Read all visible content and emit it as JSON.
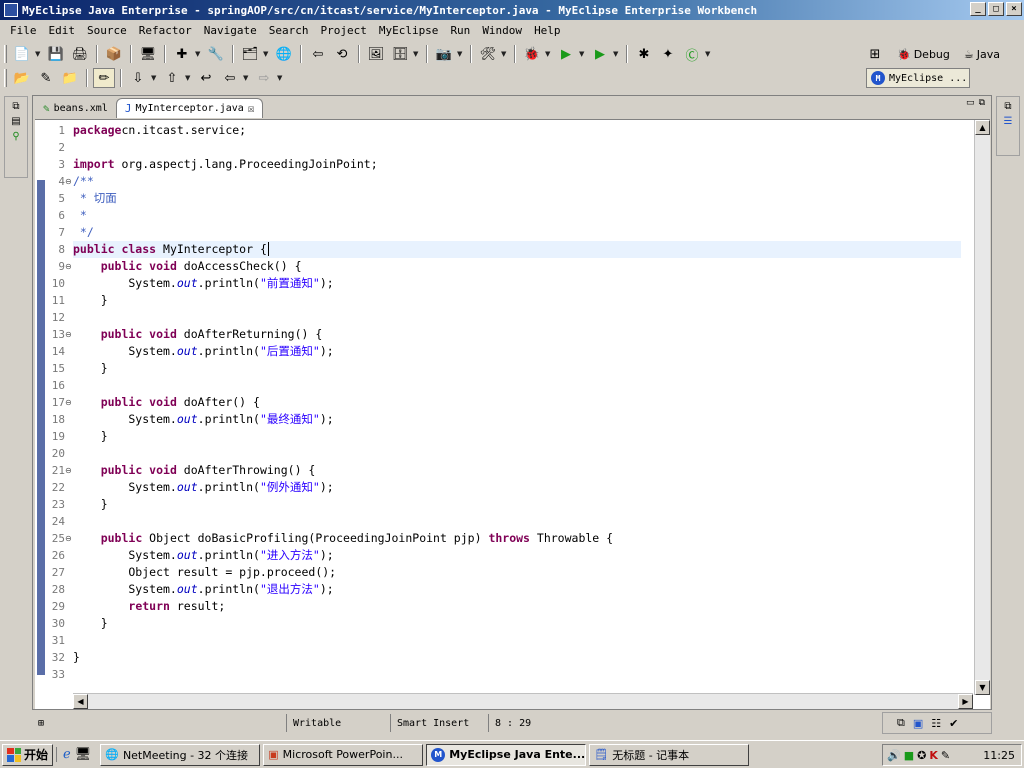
{
  "window": {
    "title": "MyEclipse Java Enterprise - springAOP/src/cn/itcast/service/MyInterceptor.java - MyEclipse Enterprise Workbench",
    "controls": [
      "_",
      "□",
      "×"
    ]
  },
  "menu": [
    "File",
    "Edit",
    "Source",
    "Refactor",
    "Navigate",
    "Search",
    "Project",
    "MyEclipse",
    "Run",
    "Window",
    "Help"
  ],
  "perspectives": {
    "debug": "Debug",
    "java": "Java",
    "active": "MyEclipse ..."
  },
  "tabs": [
    {
      "label": "beans.xml",
      "active": false
    },
    {
      "label": "MyInterceptor.java",
      "active": true
    }
  ],
  "code_lines": [
    {
      "n": "1",
      "fold": "",
      "parts": [
        [
          "kw",
          "package"
        ],
        [
          "",
          "cn.itcast.service;"
        ]
      ]
    },
    {
      "n": "2",
      "fold": "",
      "parts": []
    },
    {
      "n": "3",
      "fold": "",
      "parts": [
        [
          "kw",
          "import"
        ],
        [
          "",
          " org.aspectj.lang.ProceedingJoinPoint;"
        ]
      ]
    },
    {
      "n": "4",
      "fold": "⊖",
      "parts": [
        [
          "cm",
          "/**"
        ]
      ]
    },
    {
      "n": "5",
      "fold": "",
      "parts": [
        [
          "cm",
          " * 切面"
        ]
      ]
    },
    {
      "n": "6",
      "fold": "",
      "parts": [
        [
          "cm",
          " *"
        ]
      ]
    },
    {
      "n": "7",
      "fold": "",
      "parts": [
        [
          "cm",
          " */"
        ]
      ]
    },
    {
      "n": "8",
      "fold": "",
      "parts": [
        [
          "kw",
          "public class"
        ],
        [
          "",
          " MyInterceptor {"
        ]
      ],
      "current": true
    },
    {
      "n": "9",
      "fold": "⊖",
      "parts": [
        [
          "",
          "    "
        ],
        [
          "kw",
          "public void"
        ],
        [
          "",
          " doAccessCheck() {"
        ]
      ]
    },
    {
      "n": "10",
      "fold": "",
      "parts": [
        [
          "",
          "        System."
        ],
        [
          "fld",
          "out"
        ],
        [
          "",
          ".println("
        ],
        [
          "st",
          "\"前置通知\""
        ],
        [
          "",
          ");"
        ]
      ]
    },
    {
      "n": "11",
      "fold": "",
      "parts": [
        [
          "",
          "    }"
        ]
      ]
    },
    {
      "n": "12",
      "fold": "",
      "parts": []
    },
    {
      "n": "13",
      "fold": "⊖",
      "parts": [
        [
          "",
          "    "
        ],
        [
          "kw",
          "public void"
        ],
        [
          "",
          " doAfterReturning() {"
        ]
      ]
    },
    {
      "n": "14",
      "fold": "",
      "parts": [
        [
          "",
          "        System."
        ],
        [
          "fld",
          "out"
        ],
        [
          "",
          ".println("
        ],
        [
          "st",
          "\"后置通知\""
        ],
        [
          "",
          ");"
        ]
      ]
    },
    {
      "n": "15",
      "fold": "",
      "parts": [
        [
          "",
          "    }"
        ]
      ]
    },
    {
      "n": "16",
      "fold": "",
      "parts": []
    },
    {
      "n": "17",
      "fold": "⊖",
      "parts": [
        [
          "",
          "    "
        ],
        [
          "kw",
          "public void"
        ],
        [
          "",
          " doAfter() {"
        ]
      ]
    },
    {
      "n": "18",
      "fold": "",
      "parts": [
        [
          "",
          "        System."
        ],
        [
          "fld",
          "out"
        ],
        [
          "",
          ".println("
        ],
        [
          "st",
          "\"最终通知\""
        ],
        [
          "",
          ");"
        ]
      ]
    },
    {
      "n": "19",
      "fold": "",
      "parts": [
        [
          "",
          "    }"
        ]
      ]
    },
    {
      "n": "20",
      "fold": "",
      "parts": []
    },
    {
      "n": "21",
      "fold": "⊖",
      "parts": [
        [
          "",
          "    "
        ],
        [
          "kw",
          "public void"
        ],
        [
          "",
          " doAfterThrowing() {"
        ]
      ]
    },
    {
      "n": "22",
      "fold": "",
      "parts": [
        [
          "",
          "        System."
        ],
        [
          "fld",
          "out"
        ],
        [
          "",
          ".println("
        ],
        [
          "st",
          "\"例外通知\""
        ],
        [
          "",
          ");"
        ]
      ]
    },
    {
      "n": "23",
      "fold": "",
      "parts": [
        [
          "",
          "    }"
        ]
      ]
    },
    {
      "n": "24",
      "fold": "",
      "parts": []
    },
    {
      "n": "25",
      "fold": "⊖",
      "parts": [
        [
          "",
          "    "
        ],
        [
          "kw",
          "public"
        ],
        [
          "",
          " Object doBasicProfiling(ProceedingJoinPoint pjp) "
        ],
        [
          "kw",
          "throws"
        ],
        [
          "",
          " Throwable {"
        ]
      ]
    },
    {
      "n": "26",
      "fold": "",
      "parts": [
        [
          "",
          "        System."
        ],
        [
          "fld",
          "out"
        ],
        [
          "",
          ".println("
        ],
        [
          "st",
          "\"进入方法\""
        ],
        [
          "",
          ");"
        ]
      ]
    },
    {
      "n": "27",
      "fold": "",
      "parts": [
        [
          "",
          "        Object result = pjp.proceed();"
        ]
      ]
    },
    {
      "n": "28",
      "fold": "",
      "parts": [
        [
          "",
          "        System."
        ],
        [
          "fld",
          "out"
        ],
        [
          "",
          ".println("
        ],
        [
          "st",
          "\"退出方法\""
        ],
        [
          "",
          ");"
        ]
      ]
    },
    {
      "n": "29",
      "fold": "",
      "parts": [
        [
          "",
          "        "
        ],
        [
          "kw",
          "return"
        ],
        [
          "",
          " result;"
        ]
      ]
    },
    {
      "n": "30",
      "fold": "",
      "parts": [
        [
          "",
          "    }"
        ]
      ]
    },
    {
      "n": "31",
      "fold": "",
      "parts": []
    },
    {
      "n": "32",
      "fold": "",
      "parts": [
        [
          "",
          "}"
        ]
      ]
    },
    {
      "n": "33",
      "fold": "",
      "parts": []
    }
  ],
  "status": {
    "writable": "Writable",
    "insert_mode": "Smart Insert",
    "position": "8 : 29"
  },
  "taskbar": {
    "start": "开始",
    "tasks": [
      {
        "label": "NetMeeting - 32 个连接",
        "active": false,
        "icon": "netmeeting-icon"
      },
      {
        "label": "Microsoft PowerPoin...",
        "active": false,
        "icon": "powerpoint-icon"
      },
      {
        "label": "MyEclipse Java Ente...",
        "active": true,
        "icon": "myeclipse-icon"
      },
      {
        "label": "无标题 - 记事本",
        "active": false,
        "icon": "notepad-icon"
      }
    ],
    "clock": "11:25"
  },
  "colors": {
    "keyword": "#7f0055",
    "comment": "#3f5fbf",
    "string": "#2a00ff",
    "field": "#0000c0",
    "title_bar": "#0a246a"
  }
}
